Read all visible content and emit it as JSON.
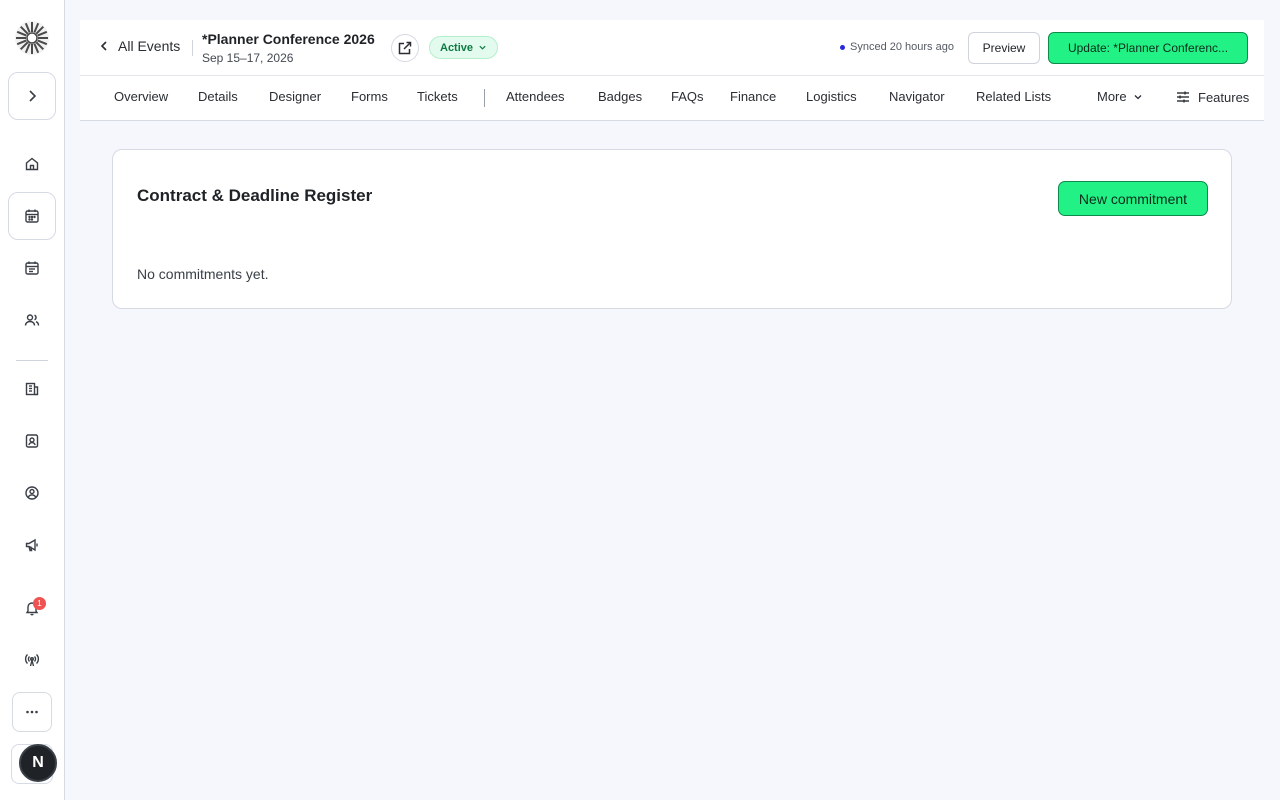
{
  "sidebar": {
    "notification_count": "1",
    "user_initial": "N"
  },
  "header": {
    "back_label": "All Events",
    "event_title": "*Planner Conference 2026",
    "event_dates": "Sep 15–17, 2026",
    "status": "Active",
    "sync_status": "Synced 20 hours ago",
    "preview_label": "Preview",
    "update_label": "Update: *Planner Conferenc..."
  },
  "tabs": {
    "overview": "Overview",
    "details": "Details",
    "designer": "Designer",
    "forms": "Forms",
    "tickets": "Tickets",
    "attendees": "Attendees",
    "badges": "Badges",
    "faqs": "FAQs",
    "finance": "Finance",
    "logistics": "Logistics",
    "navigator": "Navigator",
    "related_lists": "Related Lists",
    "more": "More",
    "features": "Features"
  },
  "card": {
    "title": "Contract & Deadline Register",
    "new_button": "New commitment",
    "empty_text": "No commitments yet."
  },
  "colors": {
    "accent": "#22f285",
    "accent_border": "#0f8a4d",
    "status_bg": "#e3fbee",
    "status_text": "#0d7a43",
    "notification": "#f05252"
  }
}
